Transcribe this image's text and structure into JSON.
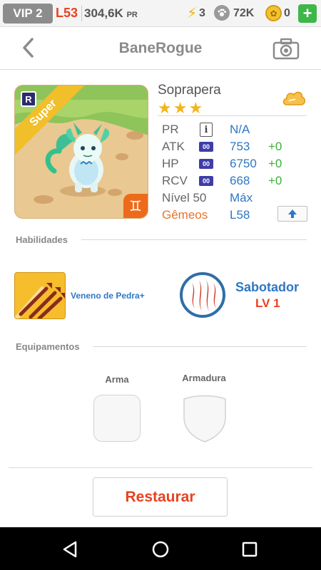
{
  "status_bar": {
    "vip": "VIP 2",
    "level": "L53",
    "power": "304,6K",
    "power_unit": "PR",
    "energy": "3",
    "food": "72K",
    "coins": "0",
    "energy_icon": "lightning-icon",
    "food_icon": "paw-icon",
    "coin_icon": "coin-icon",
    "add_icon": "plus-icon"
  },
  "header": {
    "title": "BaneRogue",
    "back_icon": "chevron-left-icon",
    "camera_icon": "camera-icon"
  },
  "pet": {
    "rank_badge": "R",
    "ribbon": "Super",
    "element_symbol": "♊",
    "name": "Soprapera",
    "stars": "★★★",
    "star_count": 3,
    "element_badge_icon": "cloud-element-icon"
  },
  "stats": {
    "pr_label": "PR",
    "pr_value": "N/A",
    "pr_info_icon": "i",
    "atk_label": "ATK",
    "atk_value": "753",
    "atk_bonus": "+0",
    "hp_label": "HP",
    "hp_value": "6750",
    "hp_bonus": "+0",
    "rcv_label": "RCV",
    "rcv_value": "668",
    "rcv_bonus": "+0",
    "potential_badge": "00",
    "level_label": "Nível 50",
    "level_value": "Máx",
    "twins_label": "Gêmeos",
    "twins_value": "L58",
    "upgrade_icon": "arrow-up-icon"
  },
  "skills": {
    "section_title": "Habilidades",
    "skill_name": "Veneno de Pedra+",
    "trait_name": "Sabotador",
    "trait_level": "LV 1"
  },
  "equipment": {
    "section_title": "Equipamentos",
    "weapon_label": "Arma",
    "armor_label": "Armadura"
  },
  "actions": {
    "restore_label": "Restaurar"
  },
  "nav": {
    "back_icon": "nav-back-icon",
    "home_icon": "nav-home-icon",
    "recents_icon": "nav-recents-icon"
  },
  "colors": {
    "accent_red": "#e8421f",
    "value_blue": "#2f77c3",
    "bonus_green": "#3ab03a",
    "twins_orange": "#e8742a",
    "star_gold": "#f2b51c"
  }
}
